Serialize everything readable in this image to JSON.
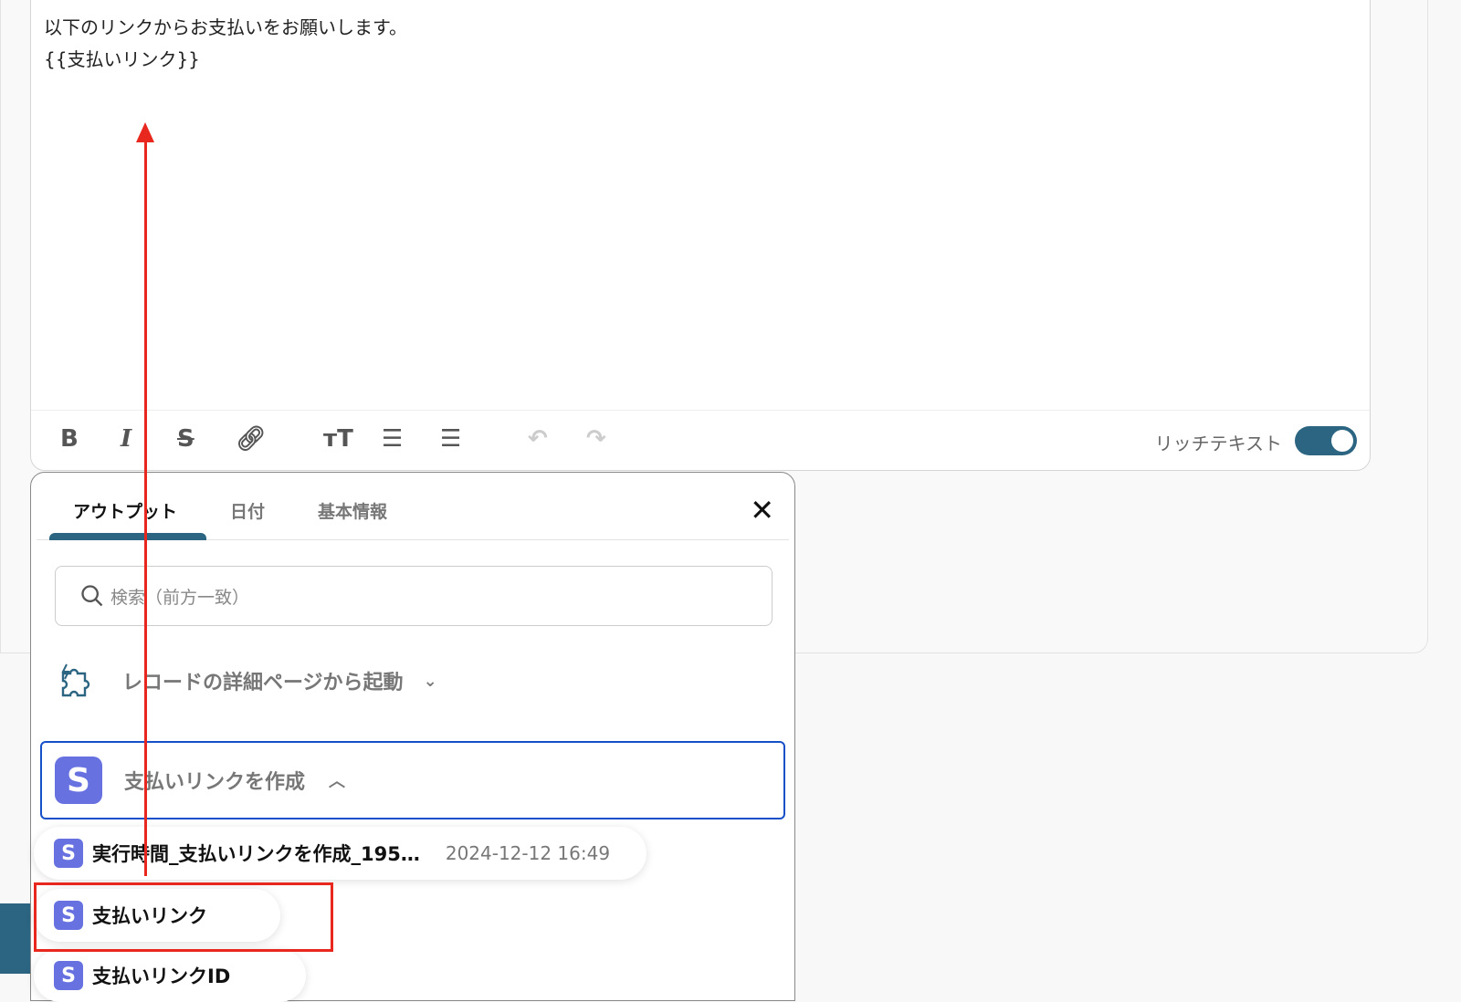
{
  "editor": {
    "lines": [
      "以下のリンクからお支払いをお願いします。",
      "{{支払いリンク}}"
    ],
    "toolbar": {
      "bold": "B",
      "italic": "I",
      "strike": "S",
      "rich_text_label": "リッチテキスト",
      "rich_text_on": true
    }
  },
  "popup": {
    "tabs": [
      "アウトプット",
      "日付",
      "基本情報"
    ],
    "active_tab": 0,
    "search_placeholder": "検索（前方一致）",
    "groups": [
      {
        "label": "レコードの詳細ページから起動",
        "expanded": false
      },
      {
        "label": "支払いリンクを作成",
        "expanded": true,
        "icon_letter": "S"
      }
    ],
    "items": [
      {
        "label": "実行時間_支払いリンクを作成_195…",
        "timestamp": "2024-12-12 16:49"
      },
      {
        "label": "支払いリンク"
      },
      {
        "label": "支払いリンクID"
      }
    ]
  },
  "colors": {
    "accent": "#2c6581",
    "stripe": "#6772e0",
    "highlight": "#e8281e",
    "focus": "#1550c8"
  }
}
